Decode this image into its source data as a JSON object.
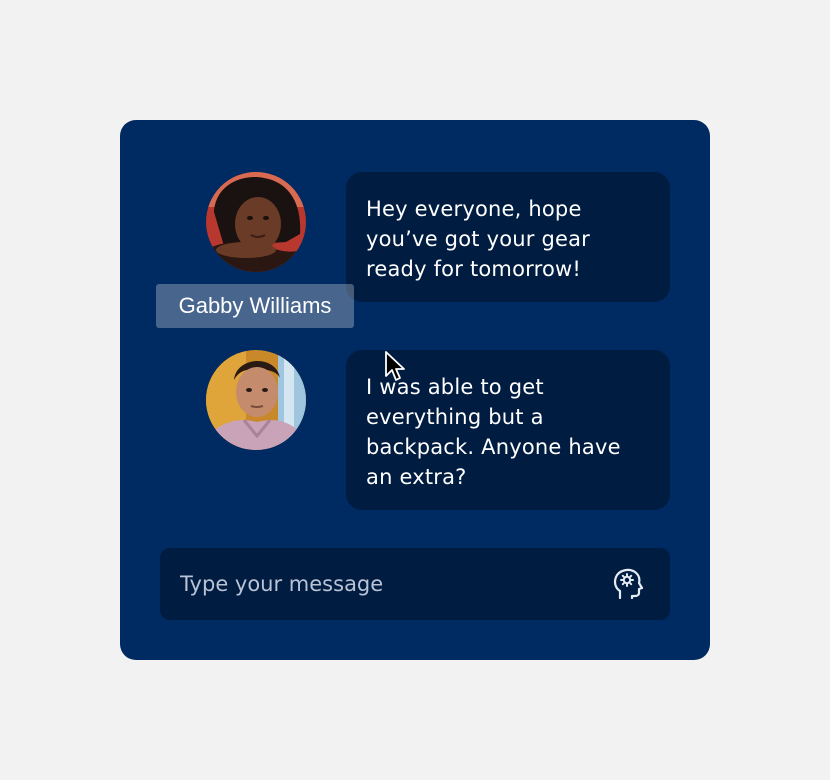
{
  "colors": {
    "page_background": "#f2f2f2",
    "card_background": "#002a62",
    "bubble_background": "#001c40",
    "text": "#ffffff",
    "placeholder": "#b8c3d6"
  },
  "messages": [
    {
      "sender": "Gabby Williams",
      "text": "Hey everyone, hope you’ve got your gear ready for tomorrow!"
    },
    {
      "text": "I was able to get everything but a backpack. Anyone have an extra?"
    }
  ],
  "hover_tooltip": {
    "label": "Gabby Williams"
  },
  "composer": {
    "placeholder": "Type your message",
    "value": "",
    "assist_icon": "head-gear-icon"
  }
}
